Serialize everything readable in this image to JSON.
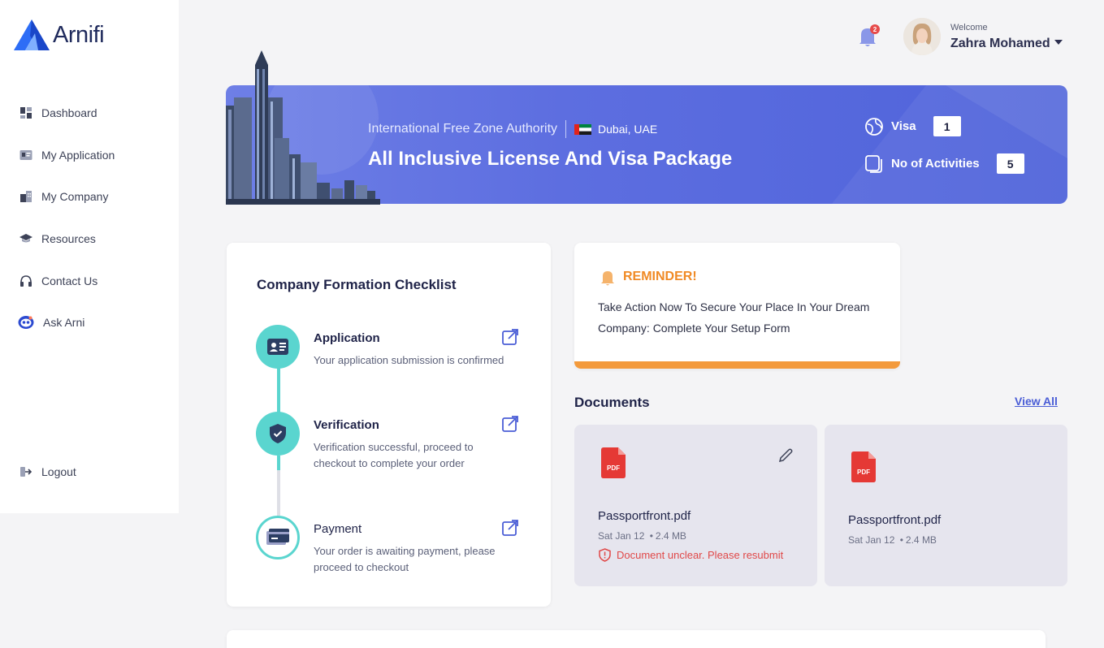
{
  "app": {
    "brand": "Arnifi"
  },
  "sidebar": {
    "items": [
      {
        "label": "Dashboard",
        "icon": "dashboard-icon"
      },
      {
        "label": "My Application",
        "icon": "application-card-icon"
      },
      {
        "label": "My Company",
        "icon": "company-building-icon"
      },
      {
        "label": "Resources",
        "icon": "graduation-cap-icon"
      },
      {
        "label": "Contact Us",
        "icon": "headphones-icon"
      },
      {
        "label": "Ask Arni",
        "icon": "robot-icon"
      }
    ],
    "logout_label": "Logout"
  },
  "header": {
    "notification_count": "2",
    "welcome": "Welcome",
    "user_name": "Zahra Mohamed"
  },
  "banner": {
    "authority": "International Free Zone Authority",
    "location": "Dubai, UAE",
    "package_title": "All Inclusive License And Visa Package",
    "visa_label": "Visa",
    "visa_count": "1",
    "activities_label": "No of Activities",
    "activities_count": "5"
  },
  "checklist": {
    "title": "Company Formation Checklist",
    "steps": [
      {
        "title": "Application",
        "description": "Your application submission is confirmed",
        "status": "complete"
      },
      {
        "title": "Verification",
        "description": "Verification successful, proceed to checkout to complete your order",
        "status": "complete"
      },
      {
        "title": "Payment",
        "description": "Your order is awaiting payment, please proceed to checkout",
        "status": "pending"
      }
    ]
  },
  "reminder": {
    "title": "REMINDER!",
    "text": "Take Action Now To Secure Your Place In Your Dream Company: Complete Your Setup Form"
  },
  "documents": {
    "title": "Documents",
    "view_all": "View All",
    "items": [
      {
        "name": "Passportfront.pdf",
        "date": "Sat Jan 12",
        "size": "2.4 MB",
        "error": "Document unclear. Please resubmit"
      },
      {
        "name": "Passportfront.pdf",
        "date": "Sat Jan 12",
        "size": "2.4 MB"
      }
    ]
  },
  "colors": {
    "accent": "#4f63da",
    "teal": "#5ad5cf",
    "reminder": "#f08a25",
    "error": "#e04848",
    "pdf_red": "#e53935"
  }
}
